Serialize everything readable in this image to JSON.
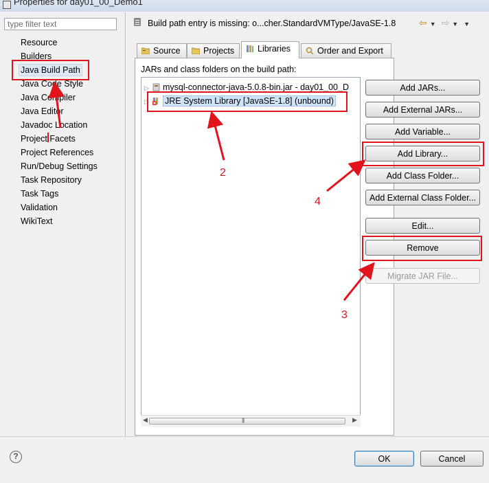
{
  "window": {
    "title": "Properties for day01_00_Demo1"
  },
  "filter": {
    "placeholder": "type filter text"
  },
  "nav": {
    "items": [
      "Resource",
      "Builders",
      "Java Build Path",
      "Java Code Style",
      "Java Compiler",
      "Java Editor",
      "Javadoc Location",
      "Project Facets",
      "Project References",
      "Run/Debug Settings",
      "Task Repository",
      "Task Tags",
      "Validation",
      "WikiText"
    ],
    "selected": "Java Build Path"
  },
  "header": {
    "message": "Build path entry is missing: o...cher.StandardVMType/JavaSE-1.8"
  },
  "tabs": {
    "source": "Source",
    "projects": "Projects",
    "libraries": "Libraries",
    "order": "Order and Export",
    "active": "Libraries"
  },
  "libraries": {
    "label": "JARs and class folders on the build path:",
    "entries": [
      "mysql-connector-java-5.0.8-bin.jar - day01_00_D",
      "JRE System Library [JavaSE-1.8] (unbound)"
    ],
    "selected_entry": "JRE System Library [JavaSE-1.8] (unbound)"
  },
  "buttons": {
    "add_jars": "Add JARs...",
    "add_external_jars": "Add External JARs...",
    "add_variable": "Add Variable...",
    "add_library": "Add Library...",
    "add_class_folder": "Add Class Folder...",
    "add_external_class_folder": "Add External Class Folder...",
    "edit": "Edit...",
    "remove": "Remove",
    "migrate_jar": "Migrate JAR File..."
  },
  "footer": {
    "ok": "OK",
    "cancel": "Cancel",
    "help_symbol": "?"
  },
  "annotations": {
    "n2": "2",
    "n3": "3",
    "n4": "4",
    "color": "#e0141a"
  },
  "icons": [
    "error-icon",
    "back-arrow-icon",
    "forward-arrow-icon",
    "menu-dropdown-icon",
    "source-folder-icon",
    "projects-icon",
    "libraries-icon",
    "order-export-icon",
    "jar-icon",
    "library-icon",
    "help-icon"
  ]
}
